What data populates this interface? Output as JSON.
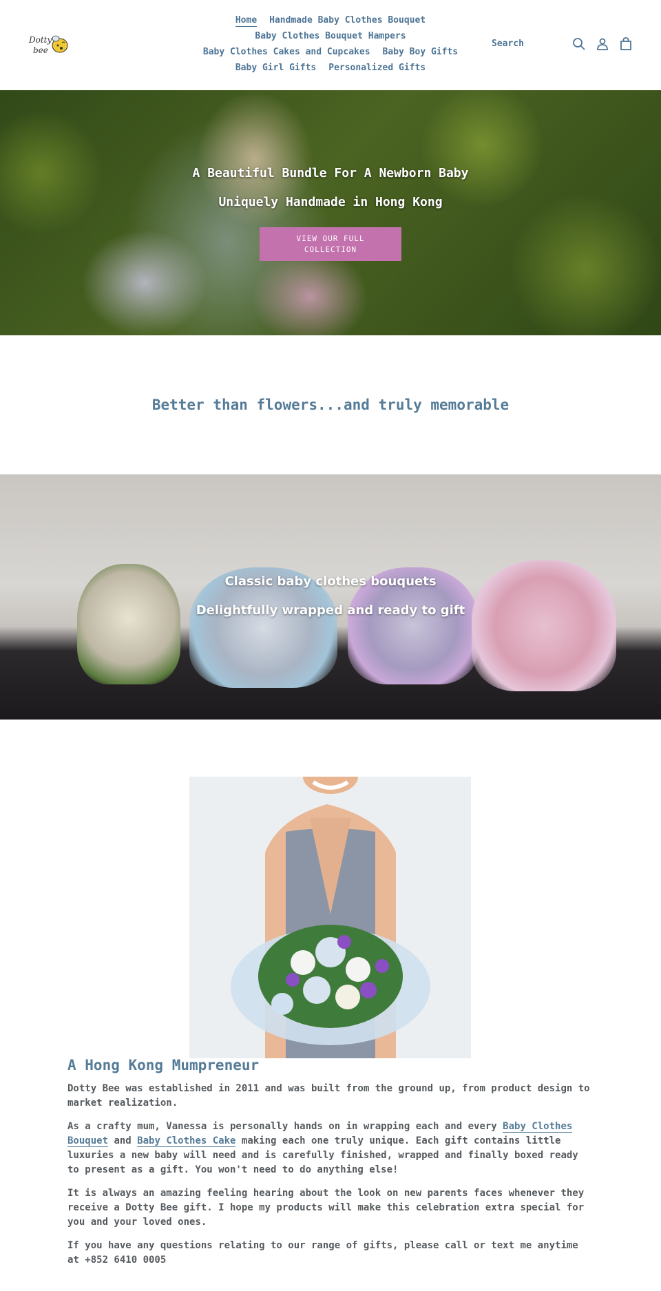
{
  "header": {
    "logo_alt": "Dotty Bee",
    "nav_rows": [
      [
        {
          "label": "Home",
          "active": true
        },
        {
          "label": "Handmade Baby Clothes Bouquet"
        }
      ],
      [
        {
          "label": "Baby Clothes Bouquet Hampers"
        }
      ],
      [
        {
          "label": "Baby Clothes Cakes and Cupcakes"
        },
        {
          "label": "Baby Boy Gifts"
        }
      ],
      [
        {
          "label": "Baby Girl Gifts"
        },
        {
          "label": "Personalized Gifts"
        }
      ]
    ],
    "search_label": "Search",
    "icons": [
      "search-icon",
      "account-icon",
      "cart-icon"
    ]
  },
  "hero1": {
    "line1": "A Beautiful Bundle For A Newborn Baby",
    "line2": "Uniquely Handmade in Hong Kong",
    "button_label": "View our full collection"
  },
  "tagline": "Better than flowers...and truly memorable",
  "hero2": {
    "line1": "Classic baby clothes bouquets",
    "line2": "Delightfully wrapped and ready to gift"
  },
  "about": {
    "heading": "A Hong Kong Mumpreneur",
    "p1": "Dotty Bee was established in 2011 and was built from the ground up, from product design to market realization.",
    "p2_before": "As a crafty mum, Vanessa is personally hands on in wrapping each and every ",
    "p2_link1": "Baby Clothes Bouquet",
    "p2_mid": " and ",
    "p2_link2": "Baby Clothes Cake",
    "p2_after": " making each one truly unique.  Each gift contains little luxuries a new baby will need and is carefully finished, wrapped and finally boxed ready to present as a gift.   You won't need to do anything else!",
    "p3": "It is always an amazing feeling hearing about the look on new parents faces whenever they receive a Dotty Bee gift.  I hope my products will make this celebration extra special for you and your loved ones.",
    "p4": "If you have any questions relating to our range of gifts, please call or text me anytime at +852 6410 0005"
  },
  "colors": {
    "accent": "#557b97",
    "button": "#c372ad",
    "body_text": "#555a5e"
  }
}
